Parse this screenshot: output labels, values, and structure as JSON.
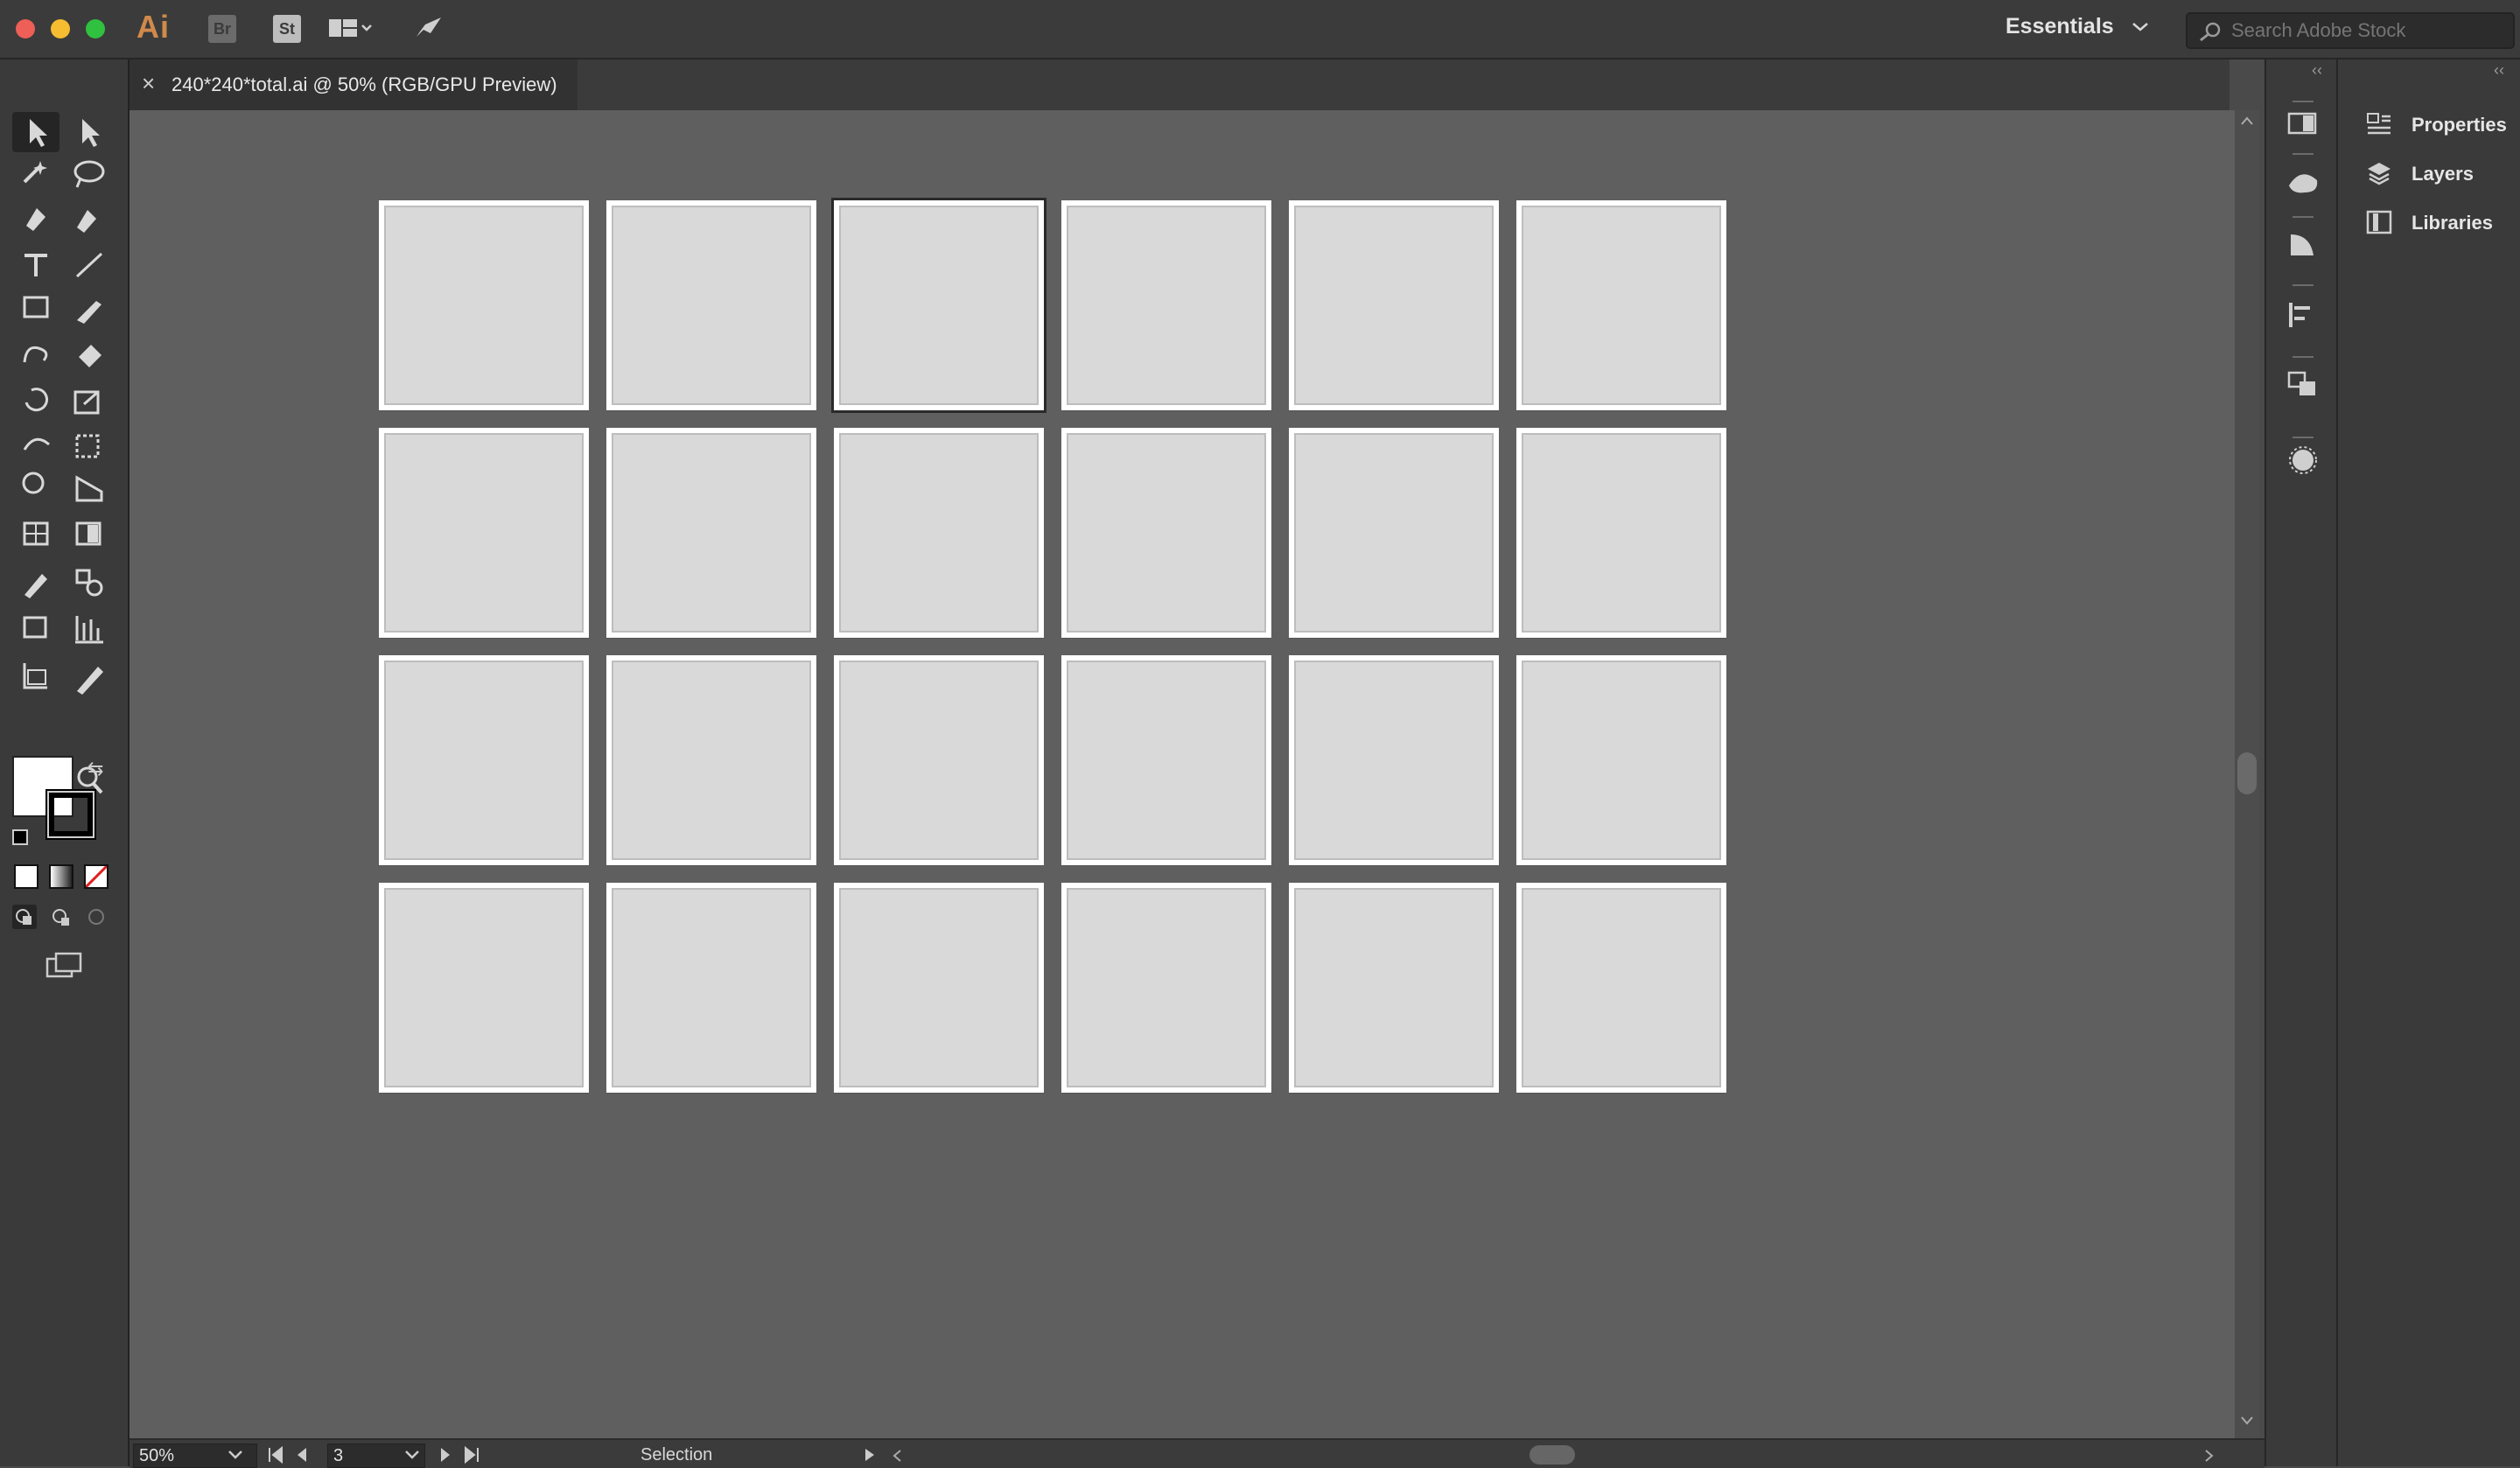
{
  "app": {
    "logo_text": "Ai",
    "bridge_label": "Br",
    "stock_label": "St"
  },
  "workspace": {
    "label": "Essentials"
  },
  "search": {
    "placeholder": "Search Adobe Stock"
  },
  "document_tab": {
    "title": "240*240*total.ai @ 50% (RGB/GPU Preview)",
    "close_symbol": "×"
  },
  "right_panel": {
    "items": [
      {
        "label": "Properties",
        "icon": "properties-icon"
      },
      {
        "label": "Layers",
        "icon": "layers-icon"
      },
      {
        "label": "Libraries",
        "icon": "libraries-icon"
      }
    ]
  },
  "status_bar": {
    "zoom": "50%",
    "artboard_number": "3",
    "tool_status": "Selection"
  },
  "artboards": {
    "columns": 6,
    "rows": 4,
    "selected_index": 2,
    "count": 24
  },
  "colors": {
    "canvas": "#5f5f5f",
    "panel": "#3a3a3a",
    "logo": "#d08a4b"
  }
}
